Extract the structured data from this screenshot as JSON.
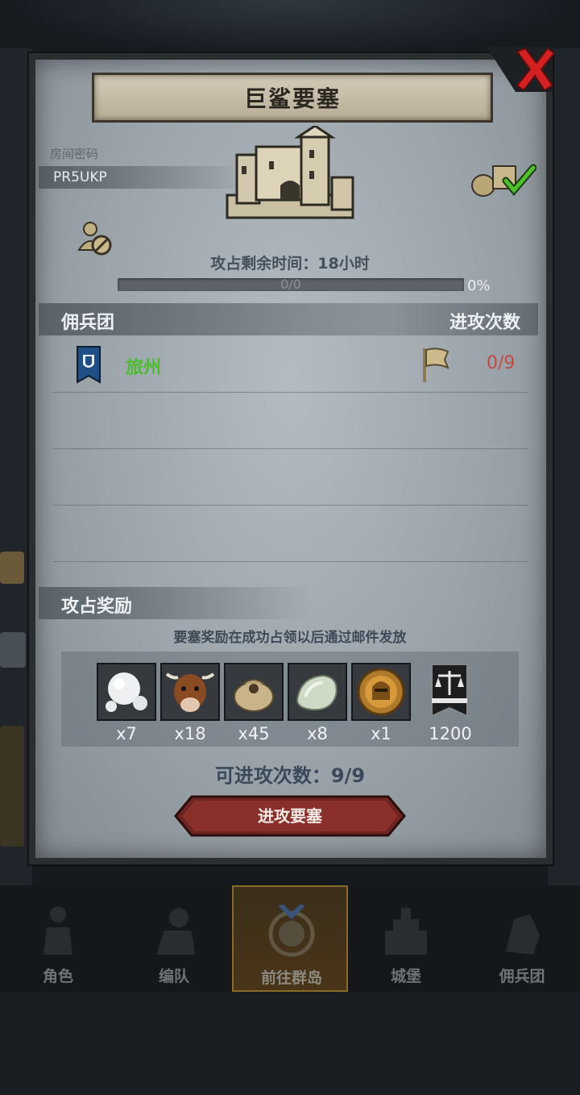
{
  "panel": {
    "title": "巨鲨要塞",
    "room_password_label": "房间密码",
    "room_password": "PR5UKP",
    "timer_label": "攻占剩余时间：",
    "timer_value": "18",
    "timer_unit": "小时",
    "progress_text": "0/0",
    "progress_percent": "0%",
    "progress_fraction": 0
  },
  "guild_table": {
    "col_guild": "佣兵团",
    "col_attacks": "进攻次数",
    "rows": [
      {
        "name": "旅州",
        "attacks": "0/9",
        "name_color": "#4bbd2c",
        "attacks_color": "#c44a42"
      }
    ]
  },
  "rewards": {
    "heading": "攻占奖励",
    "note": "要塞奖励在成功占领以后通过邮件发放",
    "items": [
      {
        "icon": "pearl-icon",
        "qty": "x7"
      },
      {
        "icon": "cow-icon",
        "qty": "x18"
      },
      {
        "icon": "coin-sack-icon",
        "qty": "x45"
      },
      {
        "icon": "jade-stone-icon",
        "qty": "x8"
      },
      {
        "icon": "knight-medal-icon",
        "qty": "x1"
      },
      {
        "icon": "justice-banner-icon",
        "qty": "1200"
      }
    ]
  },
  "footer": {
    "available_label": "可进攻次数：",
    "available_value": "9/9",
    "attack_button": "进攻要塞"
  },
  "nav": {
    "items": [
      {
        "label": "角色",
        "icon": "character-icon"
      },
      {
        "label": "编队",
        "icon": "formation-icon"
      },
      {
        "label": "前往群岛",
        "icon": "islands-icon"
      },
      {
        "label": "城堡",
        "icon": "castle-icon"
      },
      {
        "label": "佣兵团",
        "icon": "mercenary-icon"
      }
    ],
    "active_index": 2
  },
  "colors": {
    "panel_bg": "#9ba4aa",
    "banner": "#c9bfa8",
    "button_red": "#7a2a26",
    "close_red": "#d42020",
    "guild_green": "#4bbd2c",
    "count_red": "#c44a42"
  }
}
